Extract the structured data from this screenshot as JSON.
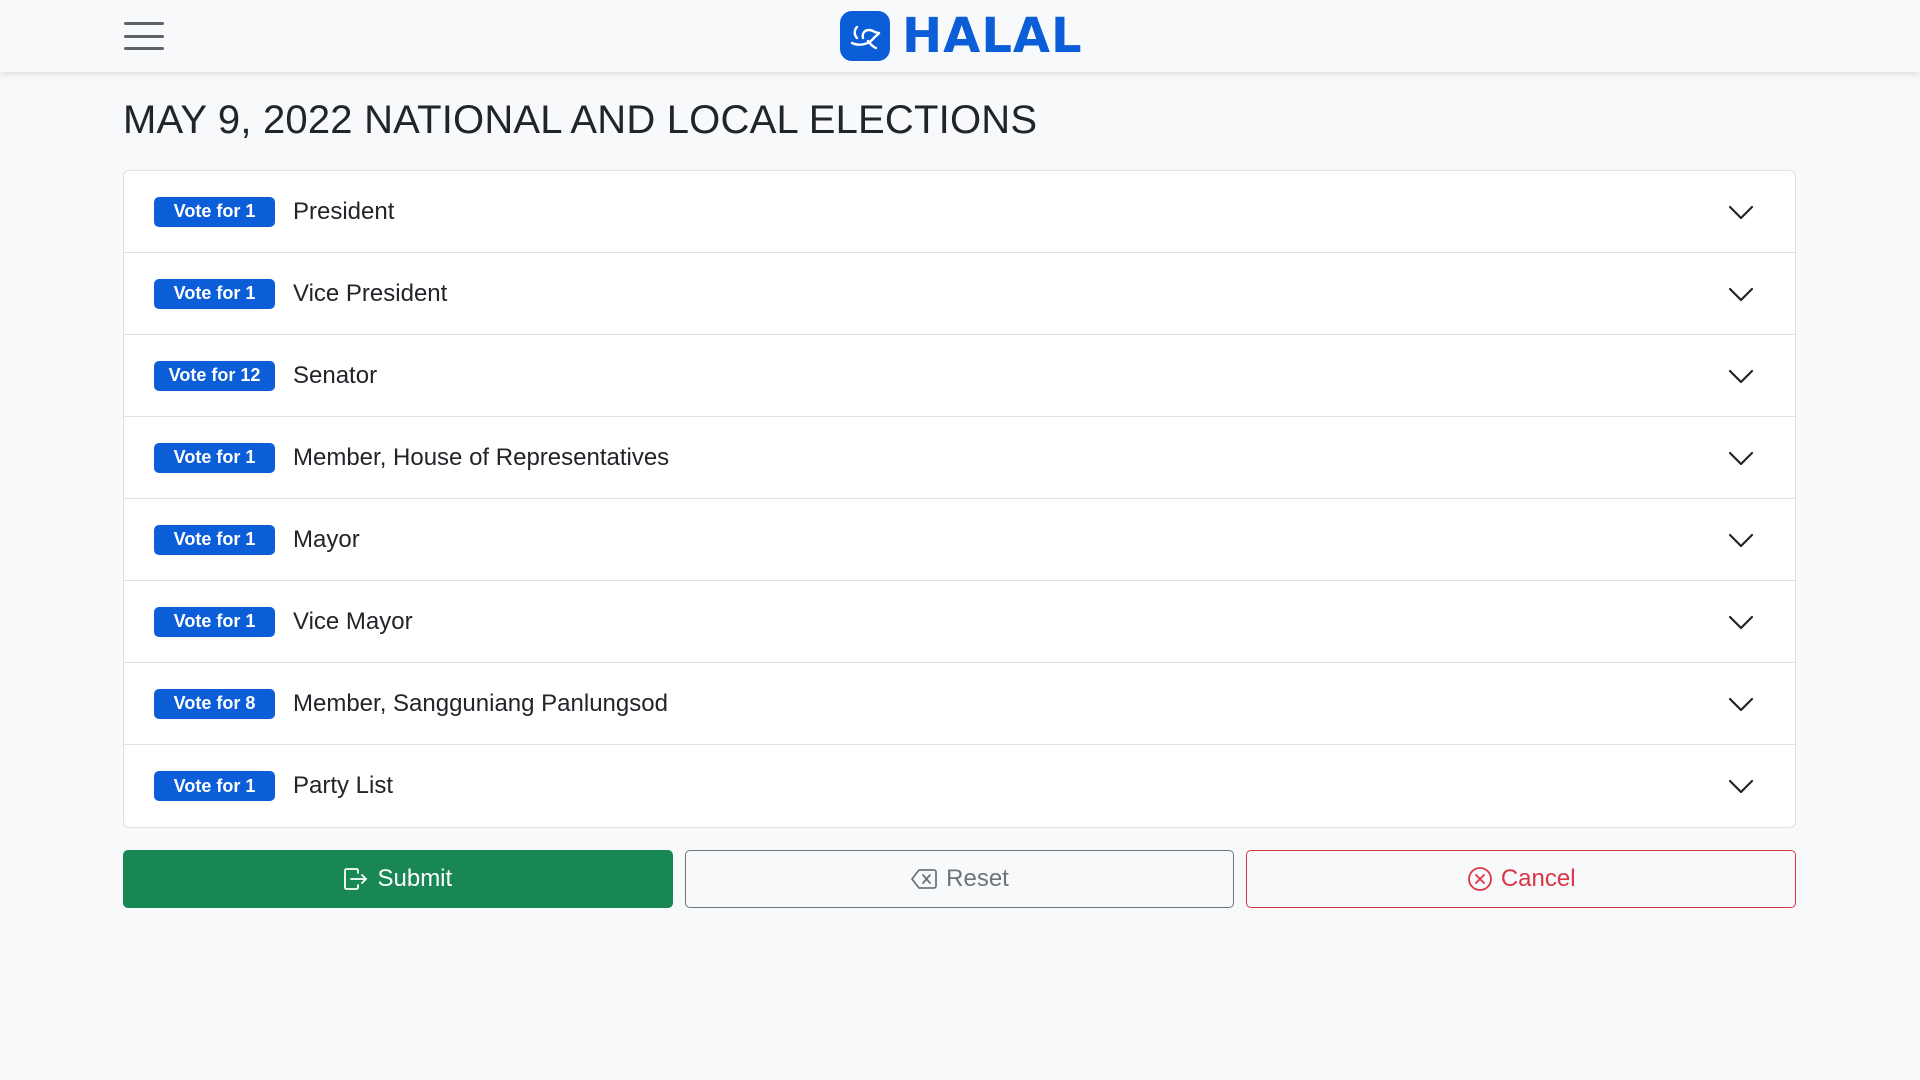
{
  "navbar": {
    "menu_icon": "hamburger-icon",
    "brand_icon": "dove-icon",
    "brand_text": "HALAL"
  },
  "page": {
    "title": "MAY 9, 2022 NATIONAL AND LOCAL ELECTIONS"
  },
  "contests": [
    {
      "badge": "Vote for 1",
      "label": "President"
    },
    {
      "badge": "Vote for 1",
      "label": "Vice President"
    },
    {
      "badge": "Vote for 12",
      "label": "Senator"
    },
    {
      "badge": "Vote for 1",
      "label": "Member, House of Representatives"
    },
    {
      "badge": "Vote for 1",
      "label": "Mayor"
    },
    {
      "badge": "Vote for 1",
      "label": "Vice Mayor"
    },
    {
      "badge": "Vote for 8",
      "label": "Member, Sangguniang Panlungsod"
    },
    {
      "badge": "Vote for 1",
      "label": "Party List"
    }
  ],
  "actions": {
    "submit_label": "Submit",
    "submit_icon": "box-arrow-right-icon",
    "reset_label": "Reset",
    "reset_icon": "backspace-icon",
    "cancel_label": "Cancel",
    "cancel_icon": "x-circle-icon"
  },
  "colors": {
    "primary": "#0b5ed7",
    "success": "#198754",
    "secondary": "#6c757d",
    "danger": "#dc3545",
    "background": "#f8f9fa"
  }
}
